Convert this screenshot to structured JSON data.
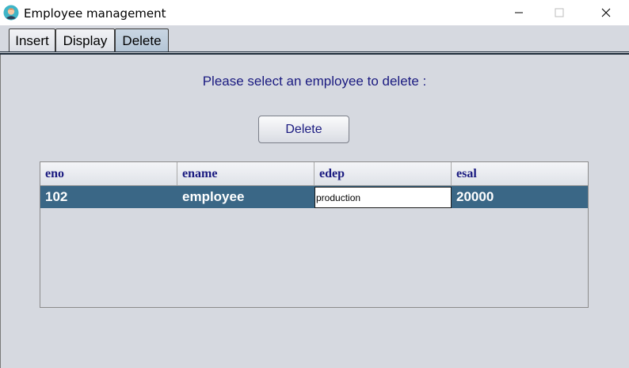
{
  "window": {
    "title": "Employee management"
  },
  "tabs": [
    {
      "label": "Insert",
      "active": false
    },
    {
      "label": "Display",
      "active": false
    },
    {
      "label": "Delete",
      "active": true
    }
  ],
  "delete_page": {
    "prompt": "Please select an employee to delete :",
    "delete_button": "Delete"
  },
  "table": {
    "columns": [
      "eno",
      "ename",
      "edep",
      "esal"
    ],
    "rows": [
      {
        "eno": "102",
        "ename": "employee",
        "edep": "production",
        "esal": "20000",
        "selected": true,
        "editing": "edep"
      }
    ]
  },
  "colors": {
    "selection": "#3a6786",
    "accent_text": "#1a1a80",
    "background": "#d6d9e0"
  },
  "icons": {
    "app": "person-avatar-icon",
    "minimize": "minimize-icon",
    "maximize": "maximize-icon",
    "close": "close-icon"
  }
}
